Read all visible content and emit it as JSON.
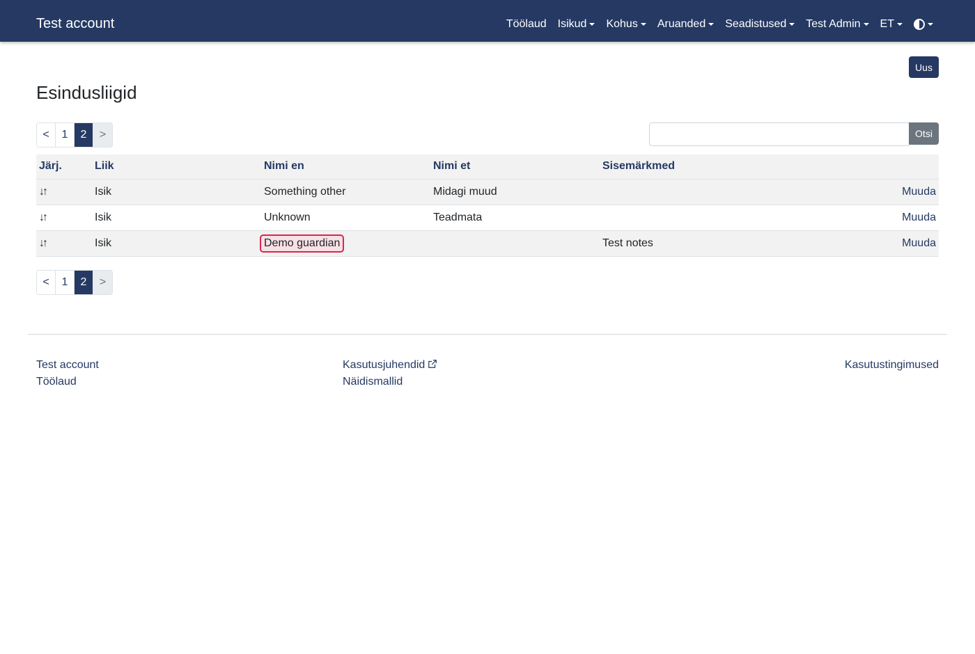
{
  "navbar": {
    "brand": "Test account",
    "items": [
      {
        "label": "Töölaud",
        "dropdown": false
      },
      {
        "label": "Isikud",
        "dropdown": true
      },
      {
        "label": "Kohus",
        "dropdown": true
      },
      {
        "label": "Aruanded",
        "dropdown": true
      },
      {
        "label": "Seadistused",
        "dropdown": true
      },
      {
        "label": "Test Admin",
        "dropdown": true
      },
      {
        "label": "ET",
        "dropdown": true
      }
    ],
    "theme_icon": "contrast-icon"
  },
  "toolbar": {
    "new_label": "Uus"
  },
  "page": {
    "title": "Esindusliigid"
  },
  "pagination": {
    "prev": "<",
    "pages": [
      "1",
      "2"
    ],
    "active": "2",
    "next": ">"
  },
  "search": {
    "value": "",
    "button_label": "Otsi"
  },
  "table": {
    "headers": [
      "Järj.",
      "Liik",
      "Nimi en",
      "Nimi et",
      "Sisemärkmed",
      ""
    ],
    "sort_icon": "sort-arrows-icon",
    "rows": [
      {
        "type": "Isik",
        "name_en": "Something other",
        "name_et": "Midagi muud",
        "notes": "",
        "action": "Muuda"
      },
      {
        "type": "Isik",
        "name_en": "Unknown",
        "name_et": "Teadmata",
        "notes": "",
        "action": "Muuda"
      },
      {
        "type": "Isik",
        "name_en": "Demo guardian",
        "name_et": "",
        "notes": "Test notes",
        "action": "Muuda"
      }
    ],
    "highlight_color": "#d6284f"
  },
  "footer": {
    "col1": [
      "Test account",
      "Töölaud"
    ],
    "col2": [
      "Kasutusjuhendid",
      "Näidismallid"
    ],
    "col3": [
      "Kasutustingimused"
    ],
    "external_icon": "external-link-icon"
  },
  "colors": {
    "primary": "#253963",
    "muted": "#6c757d"
  }
}
